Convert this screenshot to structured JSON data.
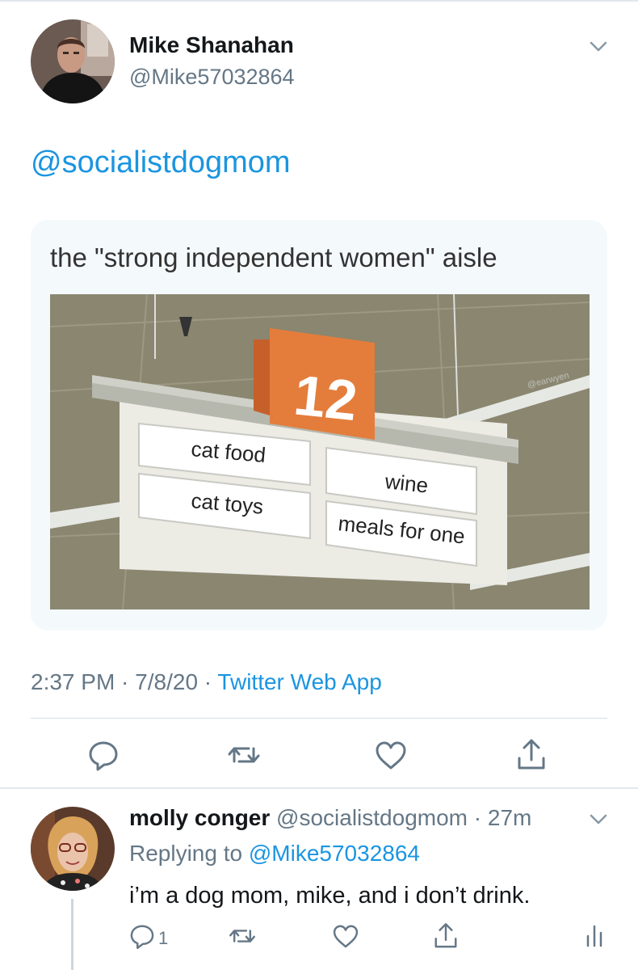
{
  "main_tweet": {
    "name": "Mike Shanahan",
    "handle": "@Mike57032864",
    "body_mention": "@socialistdogmom",
    "media": {
      "caption": "the \"strong independent women\" aisle",
      "aisle_number": "12",
      "signs": [
        "cat food",
        "cat toys",
        "wine",
        "meals for one"
      ],
      "watermark": "@earwyen"
    },
    "meta": {
      "time": "2:37 PM",
      "separator": " · ",
      "date": "7/8/20",
      "source": "Twitter Web App"
    },
    "actions": [
      "reply-icon",
      "retweet-icon",
      "like-icon",
      "share-icon"
    ]
  },
  "reply_tweet": {
    "name": "molly conger",
    "handle": "@socialistdogmom",
    "age": "27m",
    "age_separator": " · ",
    "replying_prefix": "Replying to ",
    "replying_to": "@Mike57032864",
    "text": "i’m a dog mom, mike, and i don’t drink.",
    "reply_count": "1",
    "actions": [
      "reply-icon",
      "retweet-icon",
      "like-icon",
      "share-icon",
      "analytics-icon"
    ]
  },
  "colors": {
    "link": "#1b95e0",
    "secondary": "#657786",
    "icon": "#657786",
    "border": "#e1e8ed",
    "sign_orange": "#e47d3b"
  }
}
